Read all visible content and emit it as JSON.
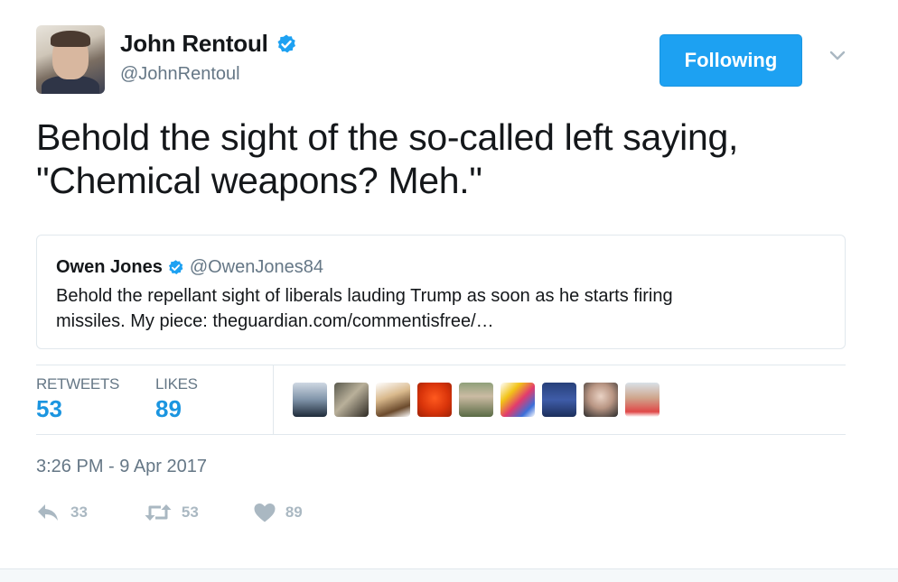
{
  "author": {
    "display_name": "John Rentoul",
    "handle": "@JohnRentoul",
    "verified": true
  },
  "follow_button": {
    "label": "Following"
  },
  "tweet": {
    "text_line1": "Behold the sight of the so-called left saying,",
    "text_line2": "\"Chemical weapons? Meh.\""
  },
  "quoted_tweet": {
    "display_name": "Owen Jones",
    "handle": "@OwenJones84",
    "verified": true,
    "text_line1": "Behold the repellant sight of liberals lauding Trump as soon as he starts firing",
    "text_line2": "missiles. My piece: theguardian.com/commentisfree/…"
  },
  "stats": {
    "retweets_label": "RETWEETS",
    "retweets_value": "53",
    "likes_label": "LIKES",
    "likes_value": "89"
  },
  "likers_icon": "avatar-thumbnails",
  "timestamp": "3:26 PM - 9 Apr 2017",
  "actions": {
    "reply_count": "33",
    "retweet_count": "53",
    "like_count": "89"
  },
  "colors": {
    "accent": "#1da1f2",
    "link_value": "#1b95e0",
    "secondary_text": "#657786",
    "action_icons": "#aab8c2"
  }
}
